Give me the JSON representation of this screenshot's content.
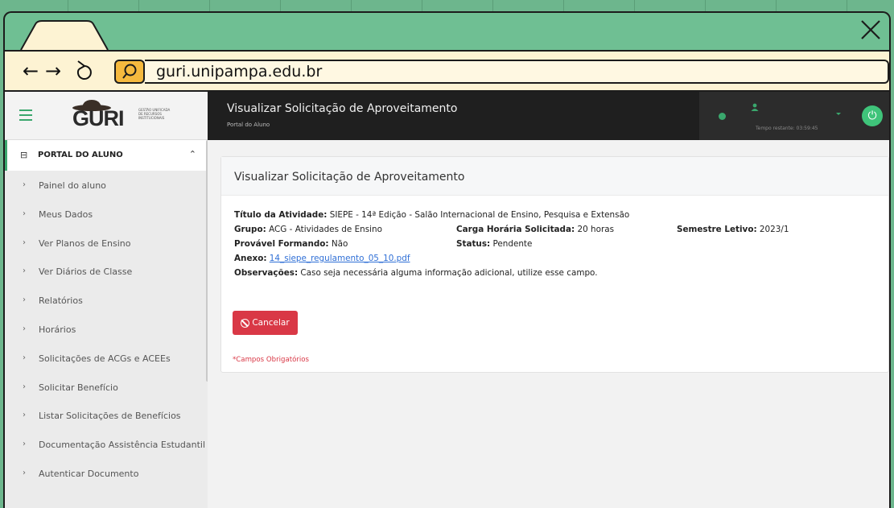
{
  "browser": {
    "url": "guri.unipampa.edu.br",
    "back_icon": "back-arrow-icon",
    "forward_icon": "forward-arrow-icon",
    "reload_icon": "reload-icon",
    "search_icon": "search-icon",
    "close_icon": "close-icon"
  },
  "sidebar": {
    "logo_text": "GURI",
    "logo_subtext": "GESTÃO UNIFICADA DE RECURSOS INSTITUCIONAIS",
    "section_label": "PORTAL DO ALUNO",
    "items": [
      {
        "label": "Painel do aluno"
      },
      {
        "label": "Meus Dados"
      },
      {
        "label": "Ver Planos de Ensino"
      },
      {
        "label": "Ver Diários de Classe"
      },
      {
        "label": "Relatórios"
      },
      {
        "label": "Horários"
      },
      {
        "label": "Solicitações de ACGs e ACEEs"
      },
      {
        "label": "Solicitar Benefício"
      },
      {
        "label": "Listar Solicitações de Benefícios"
      },
      {
        "label": "Documentação Assistência Estudantil"
      },
      {
        "label": "Autenticar Documento"
      }
    ]
  },
  "topbar": {
    "title": "Visualizar Solicitação de Aproveitamento",
    "subtitle": "Portal do Aluno",
    "timer": "Tempo restante: 03:59:45"
  },
  "card": {
    "title": "Visualizar Solicitação de Aproveitamento",
    "titulo_label": "Título da Atividade:",
    "titulo_value": "SIEPE - 14ª Edição - Salão Internacional de Ensino, Pesquisa e Extensão",
    "grupo_label": "Grupo:",
    "grupo_value": "ACG - Atividades de Ensino",
    "carga_label": "Carga Horária Solicitada:",
    "carga_value": "20 horas",
    "semestre_label": "Semestre Letivo:",
    "semestre_value": "2023/1",
    "formando_label": "Provável Formando:",
    "formando_value": "Não",
    "status_label": "Status:",
    "status_value": "Pendente",
    "anexo_label": "Anexo:",
    "anexo_value": "14_siepe_regulamento_05_10.pdf",
    "obs_label": "Observações:",
    "obs_value": "Caso seja necessária alguma informação adicional, utilize esse campo.",
    "cancel_label": "Cancelar",
    "required_note": "*Campos Obrigatórios"
  },
  "colors": {
    "accent_green": "#3aa76d",
    "danger_red": "#d93846",
    "link_blue": "#2f6fd6"
  }
}
